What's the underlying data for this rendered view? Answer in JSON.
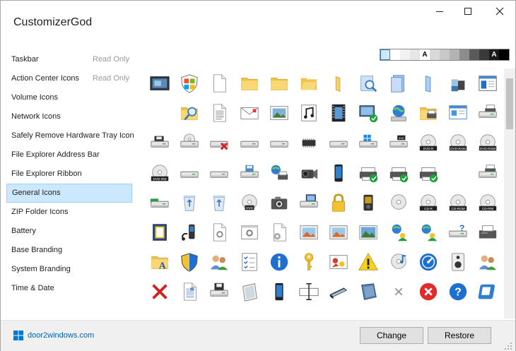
{
  "app": {
    "title": "CustomizerGod"
  },
  "window_controls": {
    "minimize": "minimize",
    "maximize": "maximize",
    "close": "close"
  },
  "sidebar": {
    "items": [
      {
        "label": "Taskbar",
        "status": "Read Only"
      },
      {
        "label": "Action Center Icons",
        "status": "Read Only"
      },
      {
        "label": "Volume Icons",
        "status": ""
      },
      {
        "label": "Network Icons",
        "status": ""
      },
      {
        "label": "Safely Remove Hardware Tray Icon",
        "status": ""
      },
      {
        "label": "File Explorer Address Bar",
        "status": ""
      },
      {
        "label": "File Explorer Ribbon",
        "status": ""
      },
      {
        "label": "General Icons",
        "status": "",
        "selected": true
      },
      {
        "label": "ZIP Folder Icons",
        "status": ""
      },
      {
        "label": "Battery",
        "status": ""
      },
      {
        "label": "Base Branding",
        "status": ""
      },
      {
        "label": "System Branding",
        "status": ""
      },
      {
        "label": "Time & Date",
        "status": ""
      }
    ]
  },
  "palette": {
    "swatches": [
      {
        "color": "#cce8ff",
        "letter": "",
        "selected": true
      },
      {
        "color": "#ffffff",
        "letter": ""
      },
      {
        "color": "#f2f2f2",
        "letter": ""
      },
      {
        "color": "#e6e6e6",
        "letter": ""
      },
      {
        "color": "#ffffff",
        "letter": "A",
        "letter_color": "#000000"
      },
      {
        "color": "#d9d9d9",
        "letter": ""
      },
      {
        "color": "#c8c8c8",
        "letter": ""
      },
      {
        "color": "#b3b3b3",
        "letter": ""
      },
      {
        "color": "#8c8c8c",
        "letter": ""
      },
      {
        "color": "#5a5a5a",
        "letter": ""
      },
      {
        "color": "#3a3a3a",
        "letter": ""
      },
      {
        "color": "#1a1a1a",
        "letter": "A",
        "letter_color": "#ffffff"
      },
      {
        "color": "#000000",
        "letter": ""
      }
    ]
  },
  "icons": {
    "rows": [
      [
        "monitor-screen-icon",
        "windows-shield-icon",
        "blank-document-icon",
        "folder-icon",
        "folder-icon",
        "folder-open-icon",
        "folder-thin-icon",
        "search-folder-icon",
        "library-icon",
        "library-slim-icon",
        "puzzle-icon",
        "window-app-icon"
      ],
      [
        "empty",
        "folder-search-icon",
        "text-document-icon",
        "envelope-icon",
        "picture-icon",
        "music-document-icon",
        "film-icon",
        "network-monitor-check-icon",
        "globe-network-icon",
        "folder-printer-icon",
        "control-panel-icon",
        "drive-printer-icon"
      ],
      [
        "floppy-drive-icon",
        "cd-drive-icon",
        "drive-error-icon",
        "drive-icon",
        "usb-drive-icon",
        "chip-icon",
        "drive-icon",
        "windows-drive-icon",
        "dvd-drive-icon",
        "dvd-r-icon",
        "dvd-ram-icon",
        "dvd-rom-icon"
      ],
      [
        "dvd-rw-icon",
        "drive-icon",
        "drive-icon",
        "floppy-tray-icon",
        "network-printer-icon",
        "camcorder-icon",
        "phone-icon",
        "printer-check-icon",
        "printer-check-icon",
        "printer-check-icon",
        "empty",
        "drive-printer-icon"
      ],
      [
        "drive-green-icon",
        "recycle-bin-icon",
        "recycle-bin-icon",
        "dvd-icon",
        "camera-icon",
        "drive-monitor-icon",
        "lock-icon",
        "media-player-icon",
        "cd-icon",
        "cd-r-icon",
        "cd-rom-icon",
        "cd-rw-icon"
      ],
      [
        "book-icon",
        "audio-device-icon",
        "settings-document-icon",
        "settings-window-icon",
        "gear-document-icon",
        "picture-frame-icon",
        "picture-frame-icon",
        "landscape-icon",
        "network-user-icon",
        "network-user-icon",
        "help-drive-icon",
        "fax-icon"
      ],
      [
        "fonts-folder-icon",
        "uac-shield-icon",
        "users-icon",
        "checklist-icon",
        "info-icon",
        "key-icon",
        "picture-collage-icon",
        "warning-icon",
        "cd-music-icon",
        "dashboard-icon",
        "speaker-icon",
        "users-icon"
      ],
      [
        "error-x-icon",
        "text-file-icon",
        "floppy-disk-icon",
        "tablet-icon",
        "phone-icon",
        "text-cursor-icon",
        "scanner-icon",
        "cube-icon",
        "small-x-icon",
        "error-circle-icon",
        "question-circle-icon",
        "disk-icon"
      ]
    ]
  },
  "footer": {
    "brand": "door2windows.com",
    "change_label": "Change",
    "restore_label": "Restore"
  }
}
